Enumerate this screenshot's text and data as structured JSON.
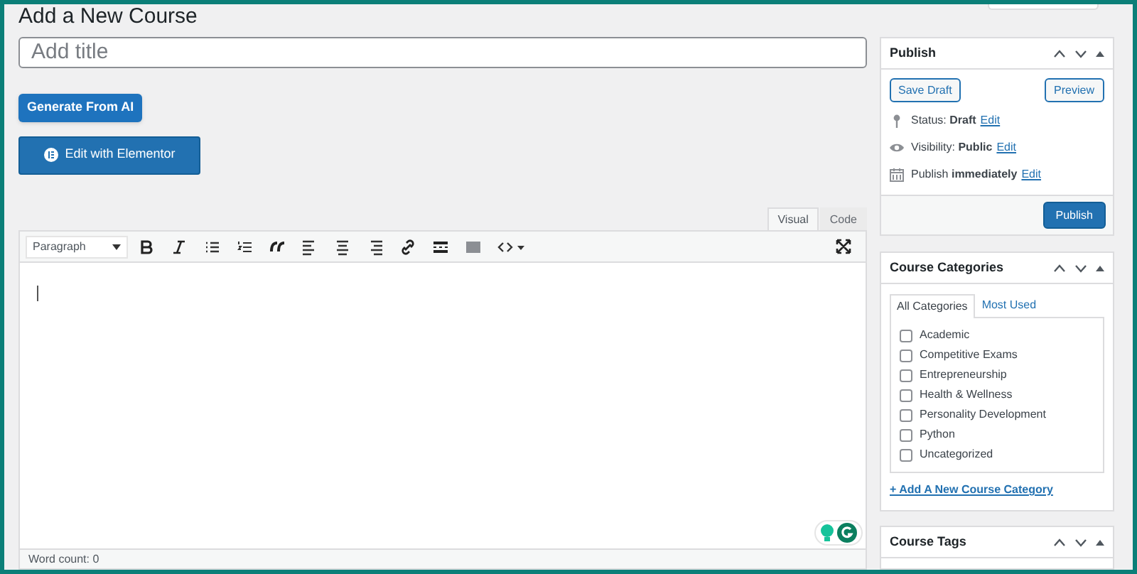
{
  "page_title": "Add a New Course",
  "title_field": {
    "placeholder": "Add title"
  },
  "generate_button": "Generate From AI",
  "elementor_button": "Edit with Elementor",
  "editor": {
    "tabs": [
      {
        "label": "Visual",
        "selected": true
      },
      {
        "label": "Code",
        "selected": false
      }
    ],
    "format_select": "Paragraph",
    "word_count": "Word count: 0"
  },
  "publish": {
    "title": "Publish",
    "save_draft": "Save Draft",
    "preview": "Preview",
    "rows": [
      {
        "kind": "status",
        "label": "Status:",
        "value": "Draft",
        "link": "Edit"
      },
      {
        "kind": "visibility",
        "label": "Visibility:",
        "value": "Public",
        "link": "Edit"
      },
      {
        "kind": "schedule",
        "label": "Publish",
        "value": "immediately",
        "link": "Edit"
      }
    ],
    "publish_button": "Publish"
  },
  "categories": {
    "title": "Course Categories",
    "tabs": [
      {
        "label": "All Categories",
        "selected": true
      },
      {
        "label": "Most Used",
        "selected": false
      }
    ],
    "items": [
      {
        "label": "Academic",
        "checked": false
      },
      {
        "label": "Competitive Exams",
        "checked": false
      },
      {
        "label": "Entrepreneurship",
        "checked": false
      },
      {
        "label": "Health & Wellness",
        "checked": false
      },
      {
        "label": "Personality Development",
        "checked": false
      },
      {
        "label": "Python",
        "checked": false
      },
      {
        "label": "Uncategorized",
        "checked": false
      }
    ],
    "add_link": "+ Add A New Course Category"
  },
  "tags": {
    "title": "Course Tags"
  }
}
